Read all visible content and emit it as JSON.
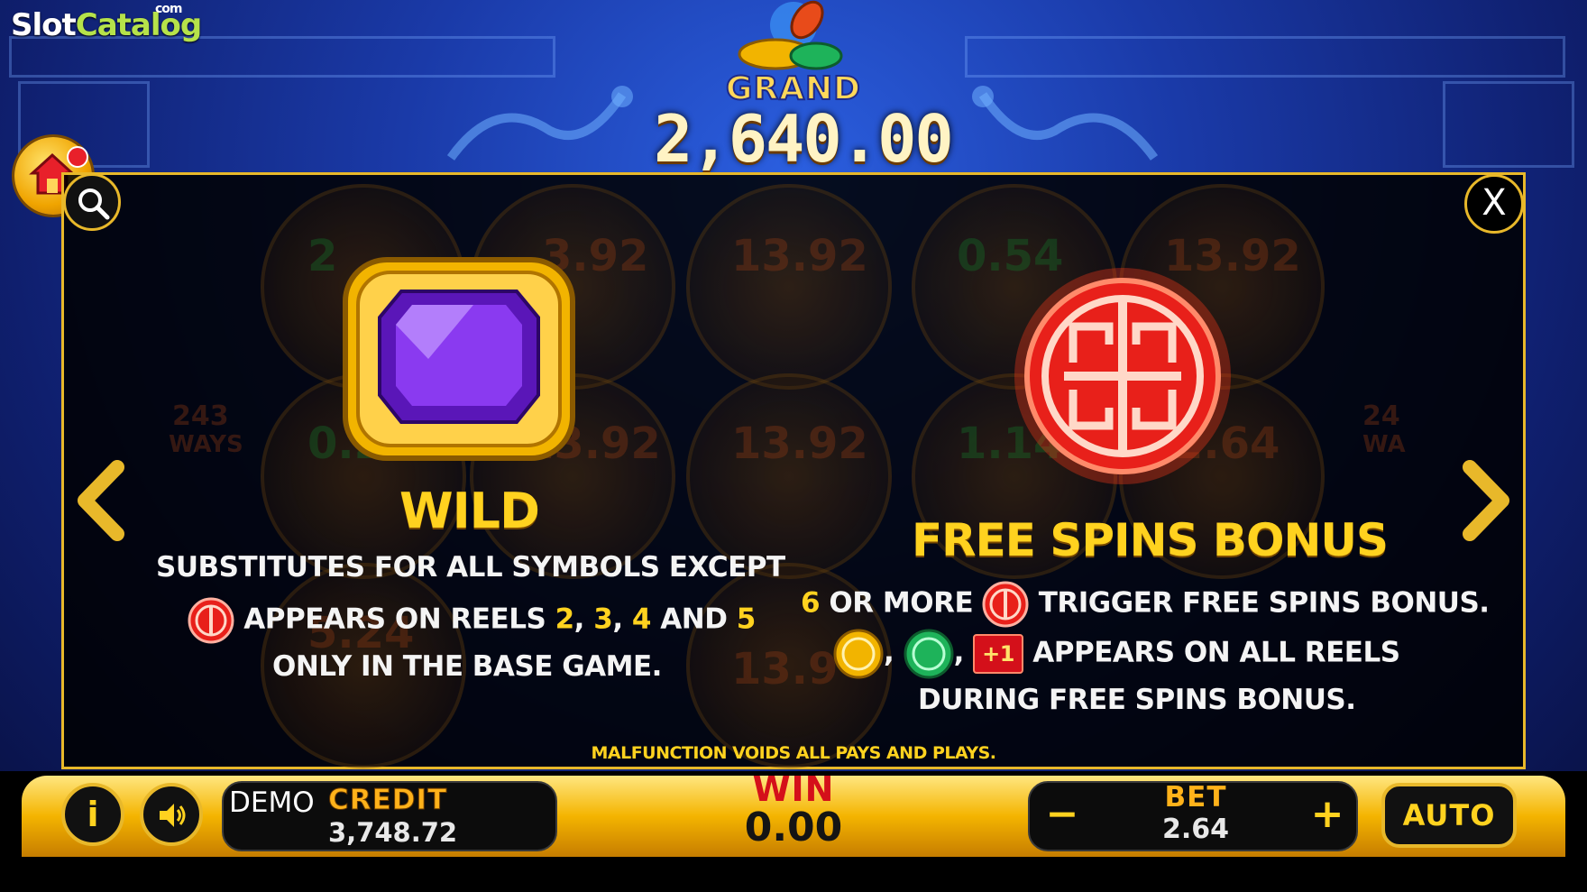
{
  "watermark": {
    "slot": "Slot",
    "catalog": "Catalog",
    "com": "com"
  },
  "jackpot": {
    "label": "GRAND",
    "value": "2,640.00"
  },
  "paytable": {
    "wild": {
      "title": "WILD",
      "line1": "SUBSTITUTES FOR ALL SYMBOLS EXCEPT",
      "line2_text": "APPEARS ON REELS",
      "reels": [
        "2",
        "3",
        "4",
        "5"
      ],
      "sep1": ",",
      "and": "AND",
      "line3": "ONLY IN THE BASE GAME."
    },
    "free_spins": {
      "title": "FREE SPINS BONUS",
      "count": "6",
      "line1_text": "OR MORE",
      "line1_end": "TRIGGER FREE SPINS BONUS.",
      "plus_badge": "+1",
      "line2_end": "APPEARS ON ALL REELS",
      "line3": "DURING FREE SPINS BONUS."
    },
    "disclaimer": "MALFUNCTION VOIDS ALL PAYS AND PLAYS.",
    "close_label": "X"
  },
  "background_ghost": [
    "2",
    "3.92",
    "13.92",
    "0.54",
    "13.92",
    "0.24",
    "13.92",
    "13.92",
    "1.14",
    "2.64",
    "5.24",
    "13.9",
    "243",
    "WAYS",
    "24",
    "WA"
  ],
  "bottom": {
    "info_label": "i",
    "demo_label": "DEMO",
    "credit_label": "CREDIT",
    "credit_value": "3,748.72",
    "win_label": "WIN",
    "win_value": "0.00",
    "bet_minus": "−",
    "bet_label": "BET",
    "bet_value": "2.64",
    "bet_plus": "+",
    "auto_label": "AUTO"
  },
  "colors": {
    "accent_gold": "#ffd21f",
    "panel_border": "#e8b82a",
    "win_red": "#d4101a"
  },
  "icons": [
    "home-icon",
    "search-icon",
    "close-icon",
    "chevron-left-icon",
    "chevron-right-icon",
    "info-icon",
    "speaker-icon",
    "wild-gem-icon",
    "red-coin-icon",
    "gold-coin-icon",
    "green-coin-icon"
  ]
}
